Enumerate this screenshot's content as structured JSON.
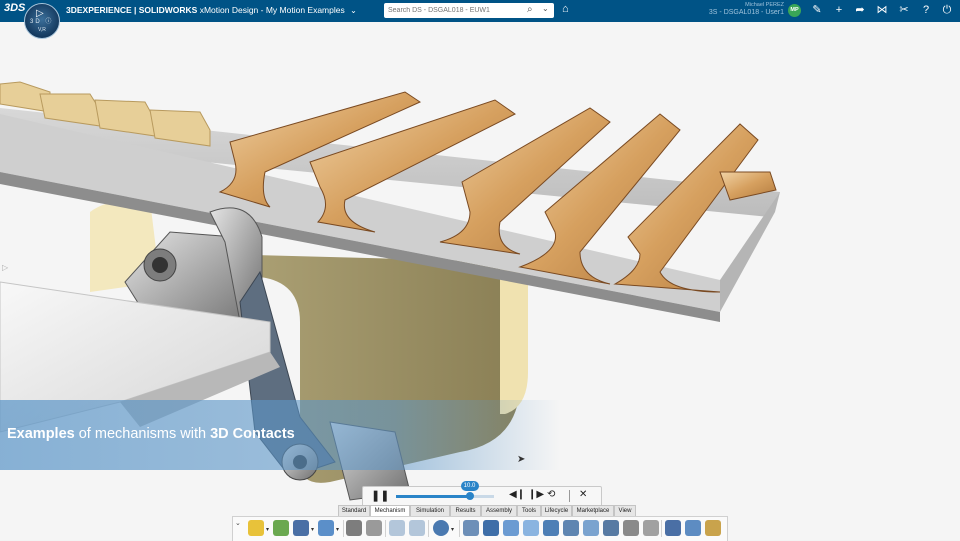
{
  "header": {
    "logo_text": "3DS",
    "compass": {
      "top": "▷",
      "middle": "3D  ⓘ",
      "bottom": "V,R"
    },
    "app_brand": "3DEXPERIENCE | SOLIDWORKS",
    "app_name": "xMotion Design - My Motion Examples",
    "search_placeholder": "Search DS - DSGAL018 - EUW1",
    "user_name": "Michael PEREZ",
    "user_tenant": "3S - DSGAL018 - User1",
    "avatar_initials": "MP",
    "icons": [
      "feather-icon",
      "plus-icon",
      "share-icon",
      "network-icon",
      "tools-icon",
      "help-icon",
      "power-icon"
    ]
  },
  "banner": {
    "part1": "Examples",
    "part2": " of mechanisms with ",
    "part3": "3D Contacts"
  },
  "player": {
    "time_value": "10.0",
    "progress": 0.75,
    "buttons": [
      "pause-icon",
      "step-back-icon",
      "step-forward-icon",
      "loop-icon",
      "close-icon"
    ]
  },
  "tabs": [
    "Standard",
    "Mechanism",
    "Simulation",
    "Results",
    "Assembly",
    "Tools",
    "Lifecycle",
    "Marketplace",
    "View"
  ],
  "active_tab": "Mechanism",
  "colors": {
    "header_bg": "#005386",
    "accent": "#2a84c8",
    "banner": "#5c96c8",
    "copper": "#d9a56a",
    "avatar": "#3aa657"
  }
}
